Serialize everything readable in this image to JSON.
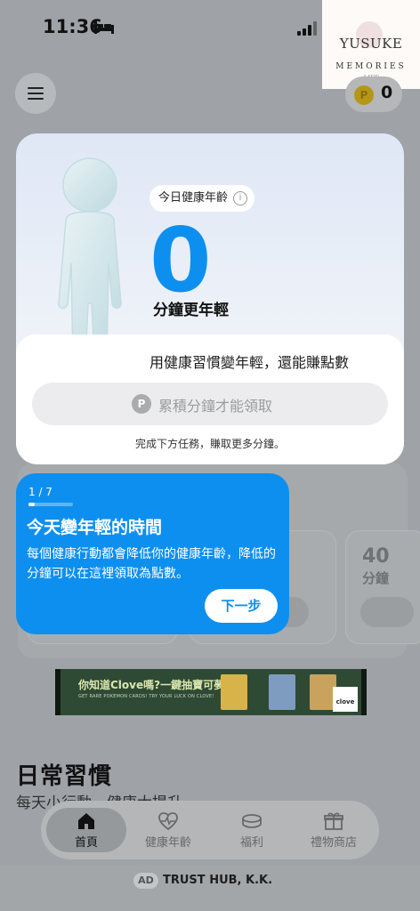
{
  "status_bar": {
    "time": "11:36"
  },
  "watermark": {
    "name": "YUSUKE",
    "subtitle": "MEMORIES",
    "signature": "LIFE"
  },
  "header": {
    "points_value": "0",
    "coin_letter": "P"
  },
  "health_card": {
    "badge_label": "今日健康年齡",
    "info_symbol": "i",
    "minutes_value": "0",
    "minutes_caption": "分鐘更年輕",
    "headline": "用健康習慣變年輕，還能賺點數",
    "claim_button_label": "累積分鐘才能領取",
    "claim_icon_letter": "P",
    "footer_note": "完成下方任務，賺取更多分鐘。"
  },
  "tooltip": {
    "step": "1 / 7",
    "progress": 0.143,
    "title": "今天變年輕的時間",
    "body": "每個健康行動都會降低你的健康年齡，降低的分鐘可以在這裡領取為點數。",
    "next_label": "下一步"
  },
  "task_cards": [
    {
      "minutes": "40",
      "unit": "分鐘"
    }
  ],
  "ad_banner": {
    "headline": "你知道Clove嗎?一鍵抽寶可夢卡!",
    "subline": "GET RARE POKEMON CARDS! TRY YOUR LUCK ON CLOVE!",
    "brand": "clove"
  },
  "habits": {
    "title": "日常習慣",
    "subtitle": "每天小行動，健康大提升"
  },
  "tabbar": {
    "tabs": [
      {
        "label": "首頁",
        "icon": "home-icon",
        "active": true
      },
      {
        "label": "健康年齡",
        "icon": "heart-pulse-icon",
        "active": false
      },
      {
        "label": "福利",
        "icon": "coins-icon",
        "active": false
      },
      {
        "label": "禮物商店",
        "icon": "gift-icon",
        "active": false
      }
    ]
  },
  "ad_footer": {
    "badge": "AD",
    "company": "TRUST HUB, K.K."
  },
  "colors": {
    "accent": "#0d8ff0",
    "overlay": "#9fa3a8"
  }
}
